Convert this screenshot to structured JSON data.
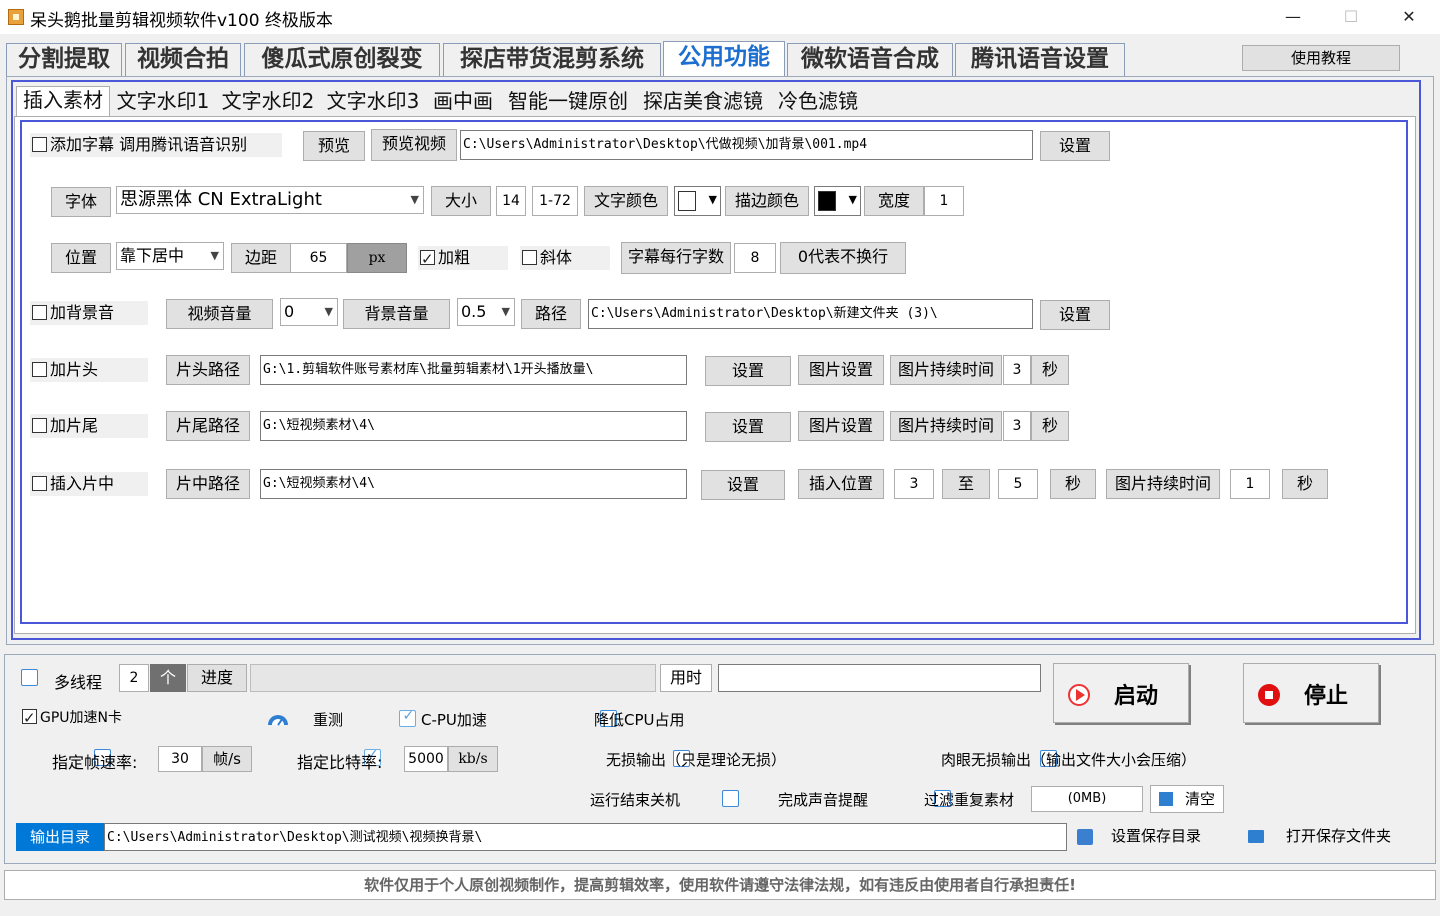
{
  "window": {
    "title": "呆头鹅批量剪辑视频软件v100 终极版本",
    "minimize": "—",
    "maximize": "☐",
    "close": "✕"
  },
  "main_tabs": [
    "分割提取",
    "视频合拍",
    "傻瓜式原创裂变",
    "探店带货混剪系统",
    "公用功能",
    "微软语音合成",
    "腾讯语音设置"
  ],
  "active_main_tab": "公用功能",
  "tutorial_button": "使用教程",
  "sub_tabs": [
    "插入素材",
    "文字水印1",
    "文字水印2",
    "文字水印3",
    "画中画",
    "智能一键原创",
    "探店美食滤镜",
    "冷色滤镜"
  ],
  "active_sub_tab": "插入素材",
  "subtitle": {
    "checkbox": "添加字幕 调用腾讯语音识别",
    "preview": "预览",
    "preview_video": "预览视频",
    "video_path": "C:\\Users\\Administrator\\Desktop\\代做视频\\加背景\\001.mp4",
    "settings": "设置"
  },
  "font_row": {
    "font_btn": "字体",
    "font_value": "思源黑体 CN ExtraLight",
    "size_btn": "大小",
    "size_value": "14",
    "size_range": "1-72",
    "text_color_btn": "文字颜色",
    "text_color": "#ffffff",
    "stroke_color_btn": "描边颜色",
    "stroke_color": "#000000",
    "width_btn": "宽度",
    "width_value": "1"
  },
  "position_row": {
    "position_btn": "位置",
    "position_value": "靠下居中",
    "margin_btn": "边距",
    "margin_value": "65",
    "margin_unit": "px",
    "bold": "加粗",
    "italic": "斜体",
    "chars_per_line_btn": "字幕每行字数",
    "chars_per_line_value": "8",
    "no_wrap_note": "0代表不换行"
  },
  "bgm_row": {
    "checkbox": "加背景音",
    "video_volume_btn": "视频音量",
    "video_volume_value": "0",
    "bg_volume_btn": "背景音量",
    "bg_volume_value": "0.5",
    "path_btn": "路径",
    "path_value": "C:\\Users\\Administrator\\Desktop\\新建文件夹 (3)\\",
    "settings": "设置"
  },
  "intro_row": {
    "checkbox": "加片头",
    "path_btn": "片头路径",
    "path_value": "G:\\1.剪辑软件账号素材库\\批量剪辑素材\\1开头播放量\\",
    "settings": "设置",
    "image_settings": "图片设置",
    "image_duration_btn": "图片持续时间",
    "image_duration_value": "3",
    "seconds": "秒"
  },
  "outro_row": {
    "checkbox": "加片尾",
    "path_btn": "片尾路径",
    "path_value": "G:\\短视频素材\\4\\",
    "settings": "设置",
    "image_settings": "图片设置",
    "image_duration_btn": "图片持续时间",
    "image_duration_value": "3",
    "seconds": "秒"
  },
  "insert_row": {
    "checkbox": "插入片中",
    "path_btn": "片中路径",
    "path_value": "G:\\短视频素材\\4\\",
    "settings": "设置",
    "insert_position_btn": "插入位置",
    "from_value": "3",
    "to_label": "至",
    "to_value": "5",
    "seconds": "秒",
    "image_duration_btn": "图片持续时间",
    "image_duration_value": "1",
    "seconds2": "秒"
  },
  "bottom": {
    "multithread": "多线程",
    "thread_count": "2",
    "thread_unit": "个",
    "progress_btn": "进度",
    "progress_fraction": 0,
    "time_used_btn": "用时",
    "time_used_value": "",
    "start": "启动",
    "stop": "停止",
    "gpu_accel": "GPU加速N卡",
    "retest": "重测",
    "cpu_accel": "C-PU加速",
    "reduce_cpu": "降低CPU占用",
    "framerate_label": "指定帧速率:",
    "framerate_value": "30",
    "framerate_unit": "帧/s",
    "bitrate_label": "指定比特率:",
    "bitrate_value": "5000",
    "bitrate_unit": "kb/s",
    "lossless": "无损输出（只是理论无损）",
    "visual_lossless": "肉眼无损输出（输出文件大小会压缩）",
    "shutdown": "运行结束关机",
    "sound_alert": "完成声音提醒",
    "filter_dup": "过滤重复素材",
    "cache_size": "(0MB)",
    "clear": "清空",
    "output_dir_btn": "输出目录",
    "output_dir_value": "C:\\Users\\Administrator\\Desktop\\测试视频\\视频换背景\\",
    "set_save_dir": "设置保存目录",
    "open_save_folder": "打开保存文件夹"
  },
  "footer": "软件仅用于个人原创视频制作，提高剪辑效率，使用软件请遵守法律法规，如有违反由使用者自行承担责任!"
}
